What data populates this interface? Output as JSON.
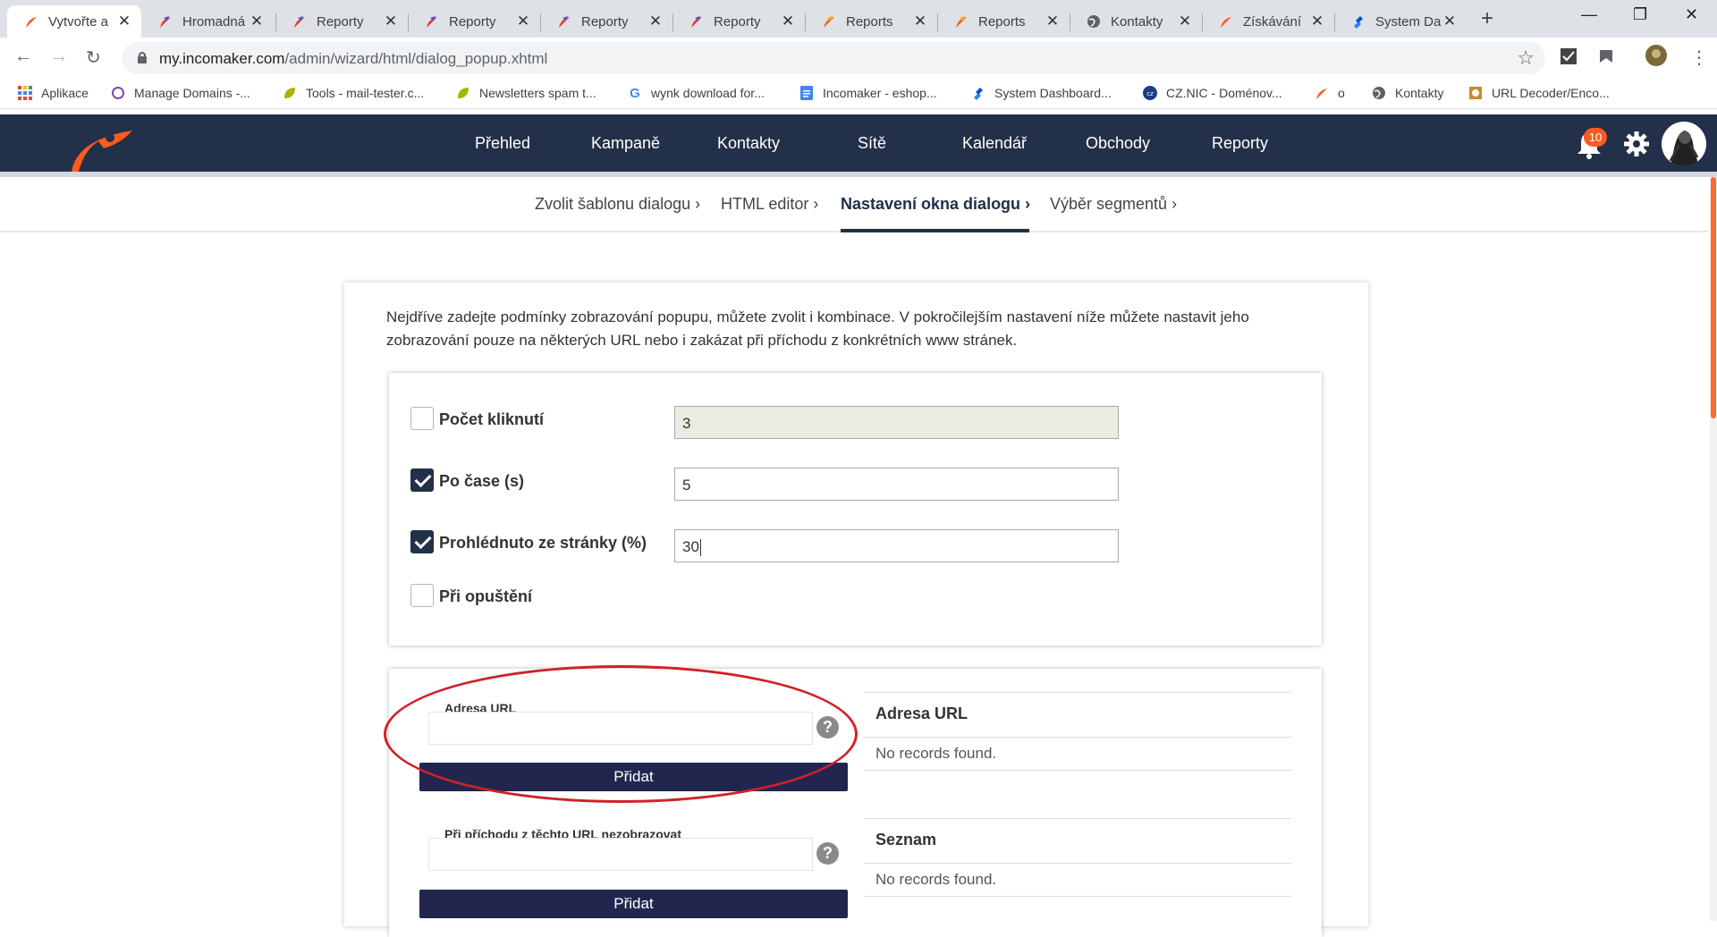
{
  "browser": {
    "tabs": [
      {
        "title": "Vytvořte a",
        "active": true
      },
      {
        "title": "Hromadná"
      },
      {
        "title": "Reporty"
      },
      {
        "title": "Reporty"
      },
      {
        "title": "Reporty"
      },
      {
        "title": "Reporty"
      },
      {
        "title": "Reports"
      },
      {
        "title": "Reports"
      },
      {
        "title": "Kontakty"
      },
      {
        "title": "Získávání"
      },
      {
        "title": "System Da"
      }
    ],
    "url_domain": "my.incomaker.com",
    "url_path": "/admin/wizard/html/dialog_popup.xhtml",
    "bookmarks": [
      "Aplikace",
      "Manage Domains -...",
      "Tools - mail-tester.c...",
      "Newsletters spam t...",
      "wynk download for...",
      "Incomaker - eshop...",
      "System Dashboard...",
      "CZ.NIC - Doménov...",
      "o",
      "Kontakty",
      "URL Decoder/Enco..."
    ]
  },
  "nav": {
    "items": [
      "Přehled",
      "Kampaně",
      "Kontakty",
      "Sítě",
      "Kalendář",
      "Obchody",
      "Reporty"
    ],
    "notification_count": "10"
  },
  "steps": [
    {
      "label": "Zvolit šablonu dialogu",
      "active": false
    },
    {
      "label": "HTML editor",
      "active": false
    },
    {
      "label": "Nastavení okna dialogu",
      "active": true
    },
    {
      "label": "Výběr segmentů",
      "active": false
    }
  ],
  "intro": "Nejdříve zadejte podmínky zobrazování popupu, můžete zvolit i kombinace. V pokročilejším nastavení níže můžete nastavit jeho zobrazování pouze na některých URL nebo i zakázat při příchodu z konkrétních www stránek.",
  "conditions": [
    {
      "label": "Počet kliknutí",
      "checked": false,
      "value": "3",
      "disabled": true
    },
    {
      "label": "Po čase (s)",
      "checked": true,
      "value": "5"
    },
    {
      "label": "Prohlédnuto ze stránky (%)",
      "checked": true,
      "value": "30"
    },
    {
      "label": "Při opuštění",
      "checked": false
    }
  ],
  "url_section": {
    "field_label": "Adresa URL",
    "add_button": "Přidat",
    "table_header": "Adresa URL",
    "empty_text": "No records found."
  },
  "exclude_section": {
    "field_label": "Při příchodu z těchto URL nezobrazovat",
    "add_button": "Přidat",
    "table_header": "Seznam",
    "empty_text": "No records found."
  },
  "colors": {
    "nav_bg": "#22304a",
    "accent": "#ff6b2c",
    "button": "#22264e",
    "annotation": "#d0212a"
  }
}
